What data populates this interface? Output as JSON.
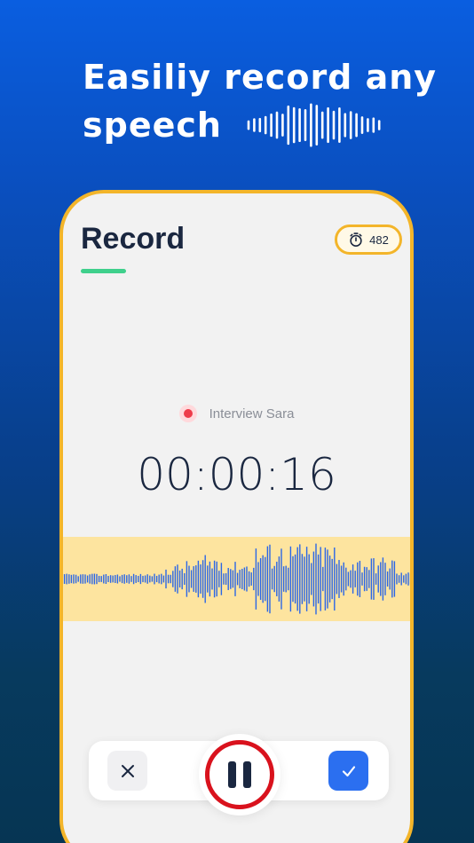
{
  "headline": {
    "line1": "Easiliy record any",
    "line2": "speech"
  },
  "screen": {
    "title": "Record",
    "credits": {
      "icon": "stopwatch-icon",
      "value": "482"
    },
    "recording": {
      "name": "Interview Sara",
      "elapsed": "00:00:16",
      "status_icon": "recording-dot-icon"
    },
    "controls": {
      "discard_icon": "close-icon",
      "pause_icon": "pause-icon",
      "confirm_icon": "check-icon"
    }
  },
  "colors": {
    "background_top": "#0a5ee0",
    "background_bottom": "#063553",
    "accent_yellow": "#f3b52a",
    "wave_band": "#fde49f",
    "wave": "#2b66e6",
    "underline_green": "#3fd08c",
    "record_red": "#d9121d",
    "confirm_blue": "#2b6ff0"
  }
}
